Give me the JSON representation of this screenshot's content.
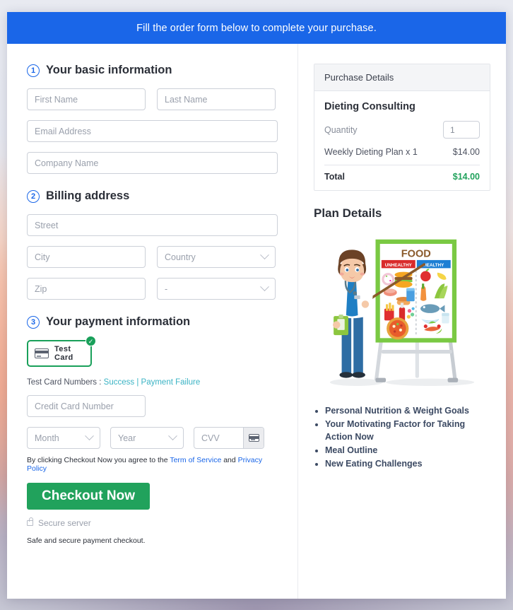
{
  "banner": {
    "text": "Fill the order form below to complete your purchase."
  },
  "sections": {
    "basic": {
      "number": "1",
      "title": "Your basic information",
      "fields": {
        "first_name": "First Name",
        "last_name": "Last Name",
        "email": "Email Address",
        "company": "Company Name"
      }
    },
    "billing": {
      "number": "2",
      "title": "Billing address",
      "fields": {
        "street": "Street",
        "city": "City",
        "country": "Country",
        "zip": "Zip",
        "state": "-"
      }
    },
    "payment": {
      "number": "3",
      "title": "Your payment information",
      "card_badge_label": "Test  Card",
      "test_numbers_prefix": "Test Card Numbers :",
      "test_numbers_success": "Success",
      "test_numbers_separator": "|",
      "test_numbers_failure": "Payment Failure",
      "fields": {
        "credit_card_number": "Credit Card Number",
        "month": "Month",
        "year": "Year",
        "cvv": "CVV"
      },
      "legal_prefix": "By clicking Checkout Now you agree to the",
      "legal_tos": "Term of Service",
      "legal_and": "and",
      "legal_privacy": "Privacy Policy",
      "checkout_label": "Checkout Now",
      "secure_label": "Secure server",
      "safe_note": "Safe and secure payment checkout."
    }
  },
  "purchase_details": {
    "header": "Purchase Details",
    "product_title": "Dieting Consulting",
    "quantity_label": "Quantity",
    "quantity_value": "1",
    "line_item_label": "Weekly Dieting Plan x 1",
    "line_item_amount": "$14.00",
    "total_label": "Total",
    "total_amount": "$14.00"
  },
  "plan_details": {
    "title": "Plan Details",
    "illustration": {
      "board_title": "FOOD",
      "unhealthy_label": "UNHEALTHY",
      "healthy_label": "HEALTHY"
    },
    "bullets": [
      "Personal Nutrition & Weight Goals",
      "Your Motivating Factor for Taking Action Now",
      "Meal Outline",
      "New Eating Challenges"
    ]
  },
  "colors": {
    "banner_blue": "#1a66e8",
    "accent_blue": "#1a66e8",
    "green": "#21a25c",
    "badge_green": "#19a05a",
    "link_teal": "#3ab3c4",
    "bullet_navy": "#3c4a63"
  }
}
